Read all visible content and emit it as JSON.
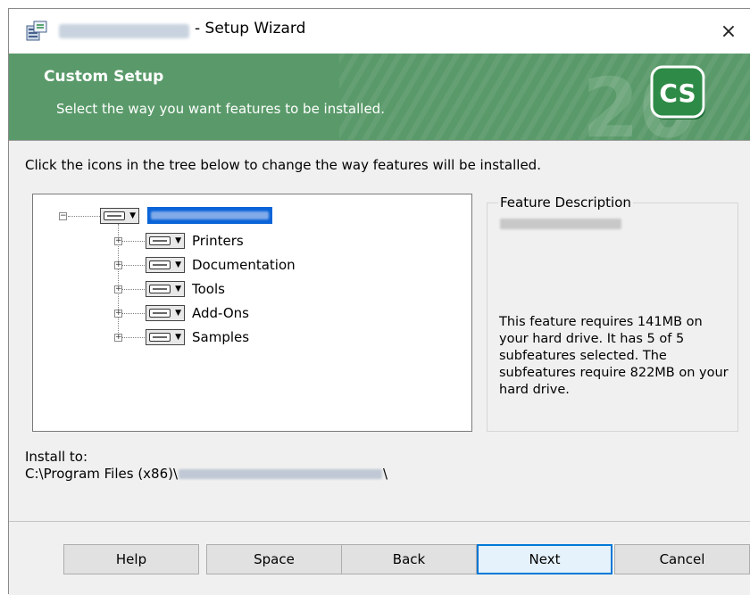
{
  "window": {
    "title": "- Setup Wizard",
    "close_glyph": "×"
  },
  "banner": {
    "title": "Custom Setup",
    "subtitle": "Select the way you want features to be installed.",
    "logo_text": "CS"
  },
  "instructions": "Click the icons in the tree below to change the way features will be installed.",
  "tree": {
    "items": [
      {
        "label": "Printers"
      },
      {
        "label": "Documentation"
      },
      {
        "label": "Tools"
      },
      {
        "label": "Add-Ons"
      },
      {
        "label": "Samples"
      }
    ]
  },
  "description": {
    "legend": "Feature Description",
    "text": "This feature requires 141MB on your hard drive. It has 5 of 5 subfeatures selected. The subfeatures require 822MB on your hard drive."
  },
  "install": {
    "label": "Install to:",
    "path_prefix": "C:\\Program Files (x86)\\",
    "path_suffix": "\\"
  },
  "buttons": {
    "help": "Help",
    "space": "Space",
    "back": "Back",
    "next": "Next",
    "cancel": "Cancel"
  },
  "colors": {
    "banner": "#5a9a6a",
    "selection": "#0a64d8",
    "default_button_border": "#0078d7",
    "logo": "#2e8b47"
  },
  "icons": {
    "title": "installer-icon",
    "close": "close-icon",
    "feature": "drive-icon",
    "dropdown": "chevron-down-icon"
  }
}
